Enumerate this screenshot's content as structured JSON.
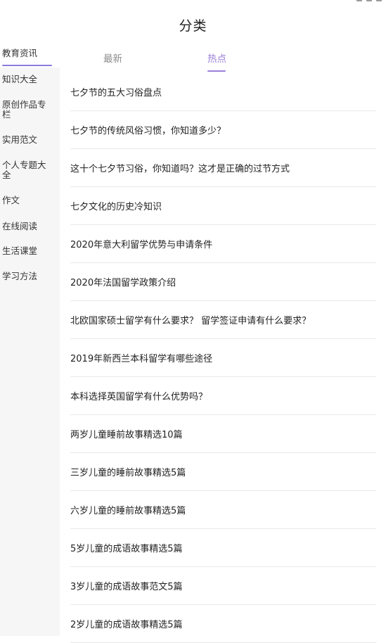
{
  "header": {
    "title": "分类"
  },
  "sidebar": {
    "items": [
      {
        "label": "教育资讯",
        "active": true
      },
      {
        "label": "知识大全"
      },
      {
        "label": "原创作品专栏"
      },
      {
        "label": "实用范文"
      },
      {
        "label": "个人专题大全"
      },
      {
        "label": "作文"
      },
      {
        "label": "在线阅读"
      },
      {
        "label": "生活课堂"
      },
      {
        "label": "学习方法"
      }
    ]
  },
  "tabs": {
    "latest": "最新",
    "hot": "热点",
    "active": "hot"
  },
  "articles": [
    "七夕节的五大习俗盘点",
    "七夕节的传统风俗习惯，你知道多少？",
    "这十个七夕节习俗，你知道吗？这才是正确的过节方式",
    "七夕文化的历史冷知识",
    "2020年意大利留学优势与申请条件",
    "2020年法国留学政策介绍",
    "北欧国家硕士留学有什么要求？ 留学签证申请有什么要求？",
    "2019年新西兰本科留学有哪些途径",
    "本科选择英国留学有什么优势吗？",
    "两岁儿童睡前故事精选10篇",
    "三岁儿童的睡前故事精选5篇",
    "六岁儿童的睡前故事精选5篇",
    "5岁儿童的成语故事精选5篇",
    "3岁儿童的成语故事范文5篇",
    "2岁儿童的成语故事精选5篇"
  ],
  "colors": {
    "accent": "#9b7fd9",
    "sidebar_bg": "#f6f6f6"
  }
}
